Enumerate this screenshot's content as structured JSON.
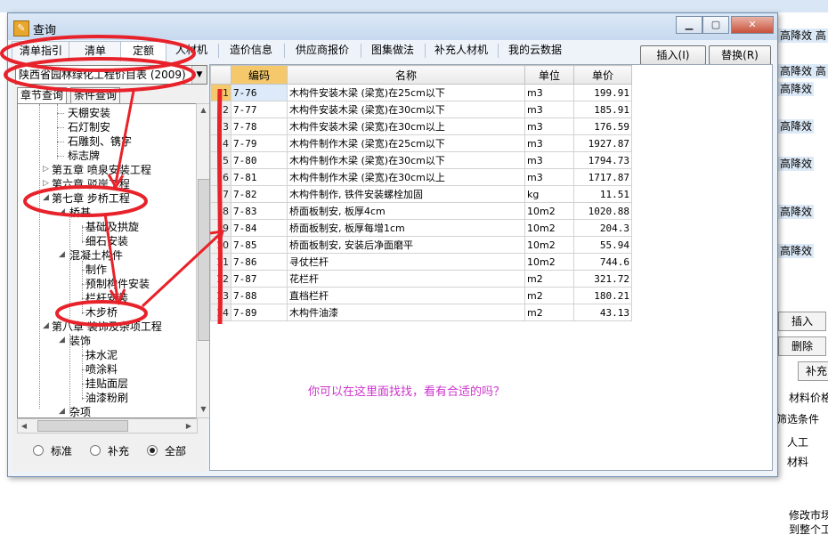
{
  "background": {
    "right_cells": [
      "高降效 高",
      "高降效 高",
      "高降效",
      "高降效",
      "高降效",
      "高降效",
      "高降效",
      "高降效"
    ],
    "right_buttons": [
      "插入",
      "删除",
      "补充"
    ],
    "right_labels": {
      "material_price": "材料价格",
      "filter": "筛选条件",
      "labor": "人工",
      "material": "材料",
      "modify_1": "修改市场",
      "modify_2": "到整个工"
    }
  },
  "window": {
    "title": "查询"
  },
  "tabs": [
    {
      "label": "清单指引"
    },
    {
      "label": "清单"
    },
    {
      "label": "定额"
    },
    {
      "label": "人材机"
    },
    {
      "label": "造价信息"
    },
    {
      "label": "供应商报价"
    },
    {
      "label": "图集做法"
    },
    {
      "label": "补充人材机"
    },
    {
      "label": "我的云数据"
    }
  ],
  "toolbar": {
    "insert_label": "插入(I)",
    "replace_label": "替换(R)"
  },
  "left": {
    "library": "陕西省园林绿化工程价目表 (2009)",
    "subtabs": [
      "章节查询",
      "条件查询"
    ],
    "tree": [
      "天棚安装",
      "石灯制安",
      "石雕刻、镌字",
      "标志牌",
      "第五章 喷泉安装工程",
      "第六章 驳岸工程",
      "第七章 步桥工程",
      "桥基",
      "基础及拱旋",
      "细石安装",
      "混凝土构件",
      "制作",
      "预制构件安装",
      "栏杆安装",
      "木步桥",
      "第八章 装饰及杂项工程",
      "装饰",
      "抹水泥",
      "喷涂料",
      "挂贴面层",
      "油漆粉刷",
      "杂项"
    ],
    "filters": [
      "标准",
      "补充",
      "全部"
    ],
    "selected_filter": "全部"
  },
  "grid": {
    "columns": [
      "编码",
      "名称",
      "单位",
      "单价"
    ],
    "rows": [
      {
        "n": "1",
        "code": "7-76",
        "name": "木构件安装木梁 (梁宽)在25cm以下",
        "unit": "m3",
        "price": "199.91"
      },
      {
        "n": "2",
        "code": "7-77",
        "name": "木构件安装木梁 (梁宽)在30cm以下",
        "unit": "m3",
        "price": "185.91"
      },
      {
        "n": "3",
        "code": "7-78",
        "name": "木构件安装木梁 (梁宽)在30cm以上",
        "unit": "m3",
        "price": "176.59"
      },
      {
        "n": "4",
        "code": "7-79",
        "name": "木构件制作木梁 (梁宽)在25cm以下",
        "unit": "m3",
        "price": "1927.87"
      },
      {
        "n": "5",
        "code": "7-80",
        "name": "木构件制作木梁 (梁宽)在30cm以下",
        "unit": "m3",
        "price": "1794.73"
      },
      {
        "n": "6",
        "code": "7-81",
        "name": "木构件制作木梁 (梁宽)在30cm以上",
        "unit": "m3",
        "price": "1717.87"
      },
      {
        "n": "7",
        "code": "7-82",
        "name": "木构件制作, 铁件安装螺栓加固",
        "unit": "kg",
        "price": "11.51"
      },
      {
        "n": "8",
        "code": "7-83",
        "name": "桥面板制安, 板厚4cm",
        "unit": "10m2",
        "price": "1020.88"
      },
      {
        "n": "9",
        "code": "7-84",
        "name": "桥面板制安, 板厚每增1cm",
        "unit": "10m2",
        "price": "204.3"
      },
      {
        "n": "10",
        "code": "7-85",
        "name": "桥面板制安, 安装后净面磨平",
        "unit": "10m2",
        "price": "55.94"
      },
      {
        "n": "11",
        "code": "7-86",
        "name": "寻仗栏杆",
        "unit": "10m2",
        "price": "744.6"
      },
      {
        "n": "12",
        "code": "7-87",
        "name": "花栏杆",
        "unit": "m2",
        "price": "321.72"
      },
      {
        "n": "13",
        "code": "7-88",
        "name": "直档栏杆",
        "unit": "m2",
        "price": "180.21"
      },
      {
        "n": "14",
        "code": "7-89",
        "name": "木构件油漆",
        "unit": "m2",
        "price": "43.13"
      }
    ],
    "note": "你可以在这里面找找，看有合适的吗？"
  },
  "colors": {
    "annotation_red": "#e8222a",
    "note_magenta": "#cc33cc",
    "header_highlight": "#f5c96b"
  }
}
